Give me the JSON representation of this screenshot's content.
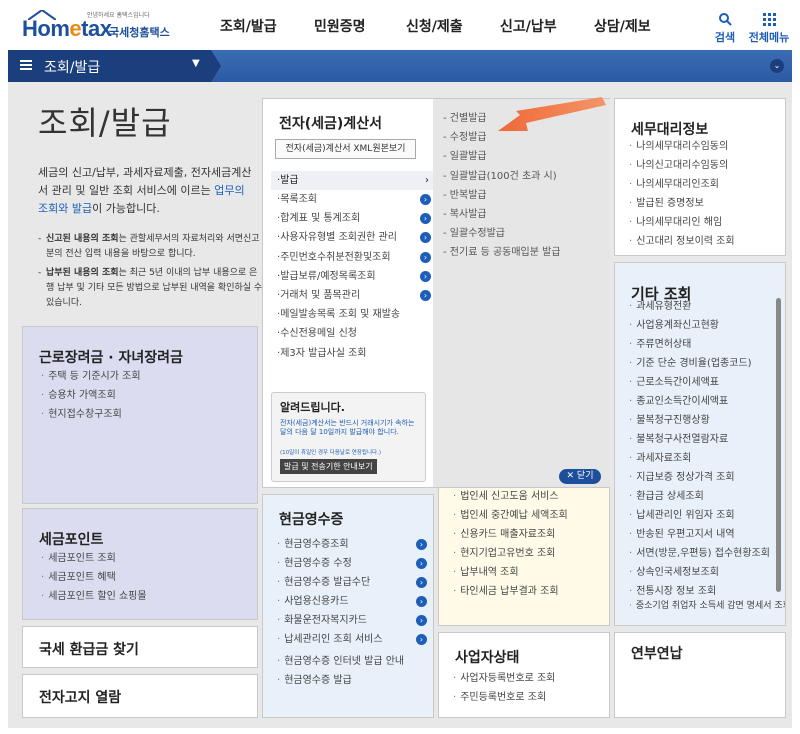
{
  "header": {
    "logo_text_home": "Hom",
    "logo_text_e": "e",
    "logo_text_tax": "tax",
    "logo_subtitle": "국세청홈택스",
    "logo_small": "안녕하세요 홈택스입니다",
    "gnb": [
      "조회/발급",
      "민원증명",
      "신청/제출",
      "신고/납부",
      "상담/제보"
    ],
    "search_label": "검색",
    "allmenu_label": "전체메뉴"
  },
  "navbar": {
    "current": "조회/발급"
  },
  "intro": {
    "title": "조회/발급",
    "desc_pre": "세금의 신고/납부, 과세자료제출, 전자세금계산서 관리 및 일반 조회 서비스에 이르는 ",
    "desc_link": "업무의 조회와 발급",
    "desc_post": "이 가능합니다.",
    "bullet1_bold": "신고된 내용의 조회",
    "bullet1_rest": "는 관할세무서의 자료처리와 서면신고분의 전산 입력 내용을 바탕으로 합니다.",
    "bullet2_bold": "납부된 내용의 조회",
    "bullet2_rest": "는 최근 5년 이내의 납부 내용으로 은행 납부 및 기타 모든 방법으로 납부된 내역을 확인하실 수 있습니다."
  },
  "efile": {
    "title": "전자(세금)계산서",
    "xml_button": "전자(세금)계산서 XML원본보기",
    "left_items": [
      "발급",
      "목록조회",
      "합계표 및 통계조회",
      "사용자유형별 조회권한 관리",
      "주민번호수취분전환및조회",
      "발급보류/예정목록조회",
      "거래처 및 품목관리",
      "메일발송목록 조회 및 재발송",
      "수신전용메일 신청",
      "제3자 발급사실 조회"
    ],
    "right_items": [
      "건별발급",
      "수정발급",
      "일괄발급",
      "일괄발급(100건 초과 시)",
      "반복발급",
      "복사발급",
      "일괄수정발급",
      "전기료 등 공동매입분 발급"
    ],
    "notice_title": "알려드립니다.",
    "notice_text": "전자(세금)계산서는 반드시 거래시기가 속하는 달의 다음 달 10일까지 발급해야 합니다.",
    "notice_small": "(10일이 휴일인 경우 다음날로 연장됩니다.)",
    "notice_button": "발급 및 전송기한 안내보기",
    "close_button": "닫기"
  },
  "agent": {
    "title": "세무대리정보",
    "items": [
      "나의세무대리수임동의",
      "나의신고대리수임동의",
      "나의세무대리인조회",
      "발급된 증명정보",
      "나의세무대리인 해임",
      "신고대리 정보이력 조회"
    ]
  },
  "etc": {
    "title": "기타 조회",
    "items": [
      "과세유형전환",
      "사업용계좌신고현황",
      "주류면허상태",
      "기준 단순 경비율(업종코드)",
      "근로소득간이세액표",
      "종교인소득간이세액표",
      "불복청구진행상황",
      "불복청구사전열람자료",
      "과세자료조회",
      "지급보증 정상가격 조회",
      "환급금 상세조회",
      "납세관리인 위임자 조회",
      "반송된 우편고지서 내역",
      "서면(방문,우편등) 접수현황조회",
      "상속인국세정보조회",
      "전통시장 정보 조회",
      "중소기업 취업자 소득세 감면 명세서 조회"
    ]
  },
  "earned": {
    "title": "근로장려금 · 자녀장려금",
    "items": [
      "주택 등 기준시가 조회",
      "승용차 가액조회",
      "현지접수창구조회"
    ]
  },
  "point": {
    "title": "세금포인트",
    "items": [
      "세금포인트 조회",
      "세금포인트 혜택",
      "세금포인트 할인 쇼핑몰"
    ]
  },
  "refund": {
    "title": "국세 환급금 찾기"
  },
  "notice_e": {
    "title": "전자고지 열람"
  },
  "cash": {
    "title": "현금영수증",
    "items": [
      "현금영수증조회",
      "현금영수증 수정",
      "현금영수증 발급수단",
      "사업용신용카드",
      "화물운전자복지카드",
      "납세관리인 조회 서비스",
      "현금영수증 인터넷 발급 안내",
      "현금영수증 발급"
    ]
  },
  "misc": {
    "items": [
      "법인세 신고도움 서비스",
      "법인세 중간예납 세액조회",
      "신용카드 매출자료조회",
      "현지기업고유번호 조회",
      "납부내역 조회",
      "타인세금 납부결과 조회"
    ]
  },
  "biz": {
    "title": "사업자상태",
    "items": [
      "사업자등록번호로 조회",
      "주민등록번호로 조회"
    ]
  },
  "yearend": {
    "title": "연부연납"
  }
}
